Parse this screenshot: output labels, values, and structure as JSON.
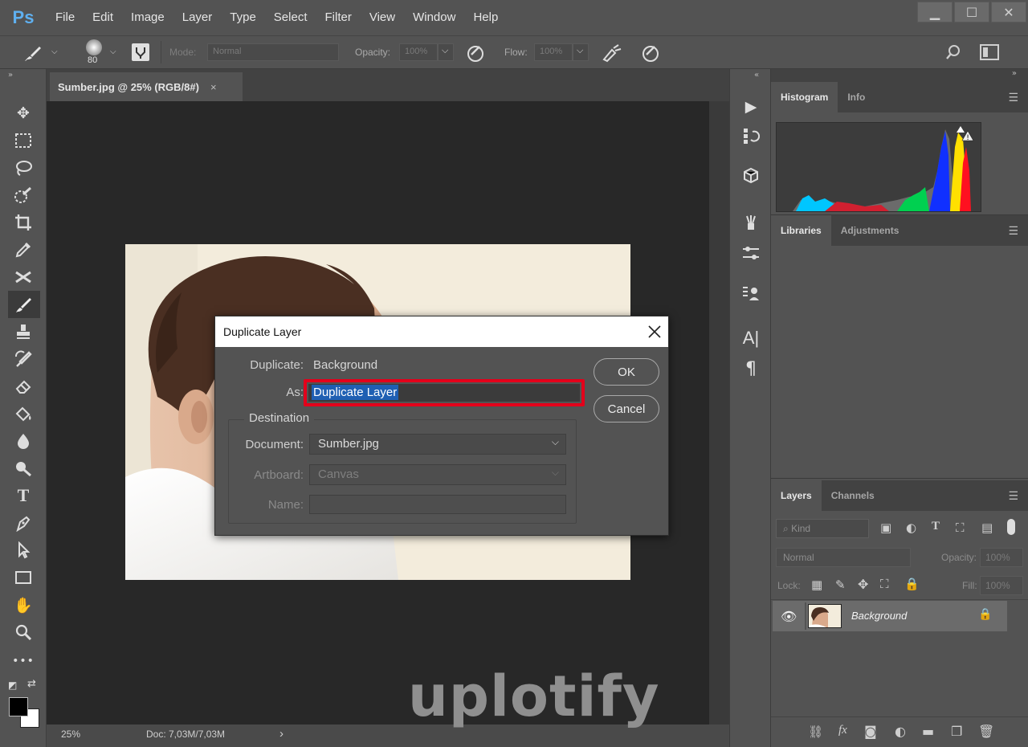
{
  "app": {
    "logo": "Ps"
  },
  "menu": [
    "File",
    "Edit",
    "Image",
    "Layer",
    "Type",
    "Select",
    "Filter",
    "View",
    "Window",
    "Help"
  ],
  "window_controls": {
    "minimize": "▁",
    "maximize": "☐",
    "close": "✕"
  },
  "options_bar": {
    "brush_size": "80",
    "mode_label": "Mode:",
    "mode_value": "Normal",
    "opacity_label": "Opacity:",
    "opacity_value": "100%",
    "flow_label": "Flow:",
    "flow_value": "100%"
  },
  "document": {
    "tab_title": "Sumber.jpg @ 25% (RGB/8#)",
    "close": "×",
    "zoom": "25%",
    "doc_info": "Doc: 7,03M/7,03M",
    "status_arrow": "›"
  },
  "panels": {
    "histogram_tabs": [
      "Histogram",
      "Info"
    ],
    "libraries_tabs": [
      "Libraries",
      "Adjustments"
    ],
    "layers_tabs": [
      "Layers",
      "Channels"
    ],
    "layers": {
      "kind_placeholder": "Kind",
      "blend_mode": "Normal",
      "opacity_label": "Opacity:",
      "opacity_value": "100%",
      "lock_label": "Lock:",
      "fill_label": "Fill:",
      "fill_value": "100%",
      "items": [
        {
          "name": "Background",
          "locked": true,
          "visible": true
        }
      ]
    },
    "bottom_icons": [
      "link-icon",
      "fx-icon",
      "mask-icon",
      "adjustment-icon",
      "folder-icon",
      "new-layer-icon",
      "trash-icon"
    ]
  },
  "dialog": {
    "title": "Duplicate Layer",
    "duplicate_label": "Duplicate:",
    "duplicate_value": "Background",
    "as_label": "As:",
    "as_value": "Duplicate Layer",
    "destination_legend": "Destination",
    "document_label": "Document:",
    "document_value": "Sumber.jpg",
    "artboard_label": "Artboard:",
    "artboard_value": "Canvas",
    "name_label": "Name:",
    "name_value": "",
    "ok": "OK",
    "cancel": "Cancel"
  },
  "watermark": "uplotify",
  "colors": {
    "highlight_box": "#e3001b",
    "selection": "#1f5fb3",
    "accent": "#5fb0f0"
  }
}
